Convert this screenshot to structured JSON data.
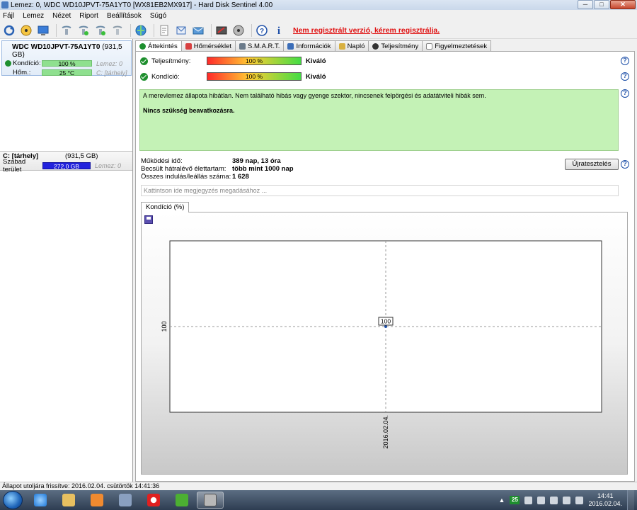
{
  "window": {
    "title": "Lemez: 0, WDC WD10JPVT-75A1YT0 [WX81EB2MX917]  -  Hard Disk Sentinel 4.00",
    "btn_min": "─",
    "btn_max": "□",
    "btn_close": "✕"
  },
  "menu": [
    "Fájl",
    "Lemez",
    "Nézet",
    "Riport",
    "Beállítások",
    "Súgó"
  ],
  "toolbar": {
    "registration_warning": "Nem regisztrált verzió, kérem regisztrálja."
  },
  "sidebar": {
    "disk_name": "WDC WD10JPVT-75A1YT0",
    "disk_size": "(931,5 GB)",
    "condition_label": "Kondíció:",
    "condition_value": "100 %",
    "condition_disk": "Lemez: 0",
    "temp_label": "Hőm.:",
    "temp_value": "25 °C",
    "temp_location": "C: [tárhely]",
    "partition_name": "C: [tárhely]",
    "partition_size": "(931,5 GB)",
    "free_label": "Szabad terület",
    "free_value": "272,0 GB",
    "free_disk": "Lemez: 0"
  },
  "tabs": [
    "Áttekintés",
    "Hőmérséklet",
    "S.M.A.R.T.",
    "Információk",
    "Napló",
    "Teljesítmény",
    "Figyelmeztetések"
  ],
  "overview": {
    "performance_label": "Teljesítmény:",
    "performance_value": "100 %",
    "performance_rating": "Kiváló",
    "condition_label": "Kondíció:",
    "condition_value": "100 %",
    "condition_rating": "Kiváló",
    "summary_text": "A merevlemez állapota hibátlan. Nem található hibás vagy gyenge szektor, nincsenek felpörgési és adatátviteli hibák sem.",
    "recommendation": "Nincs szükség beavatkozásra.",
    "uptime_label": "Működési idő:",
    "uptime_value": "389 nap, 13 óra",
    "lifetime_label": "Becsült hátralévő élettartam:",
    "lifetime_value": "több mint 1000 nap",
    "startstop_label": "Összes indulás/leállás száma:",
    "startstop_value": "1 628",
    "retest_button": "Újratesztelés",
    "note_placeholder": "Kattintson ide megjegyzés megadásához ...",
    "help": "?"
  },
  "chart_tab_label": "Kondíció  (%)",
  "chart_data": {
    "type": "line",
    "x": [
      "2016.02.04."
    ],
    "series": [
      {
        "values": [
          100
        ]
      }
    ],
    "xlabel": "",
    "ylabel": "",
    "y_tick_labels": [
      "100"
    ],
    "x_tick_labels": [
      "2016.02.04."
    ],
    "point_labels": [
      "100"
    ],
    "grid": true
  },
  "statusbar": {
    "text": "Állapot utoljára frissítve: 2016.02.04. csütörtök 14:41:36"
  },
  "taskbar": {
    "tray_badge": "25",
    "time": "14:41",
    "date": "2016.02.04."
  },
  "colors": {
    "ok_green": "#1e8f2e",
    "summary_bg": "#c4f2b6",
    "warning_red": "#e01010",
    "free_space_blue": "#2222dd"
  }
}
